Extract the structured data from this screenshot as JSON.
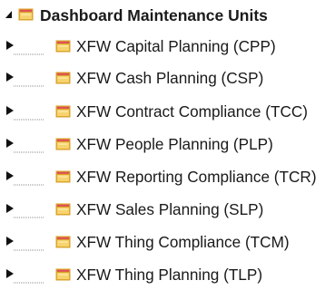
{
  "tree": {
    "root": {
      "label": "Dashboard Maintenance Units",
      "expanded": true
    },
    "children": [
      {
        "label": "XFW Capital Planning  (CPP)",
        "expanded": false
      },
      {
        "label": "XFW Cash Planning  (CSP)",
        "expanded": false
      },
      {
        "label": "XFW Contract Compliance (TCC)",
        "expanded": false
      },
      {
        "label": "XFW People Planning  (PLP)",
        "expanded": false
      },
      {
        "label": "XFW Reporting Compliance (TCR)",
        "expanded": false
      },
      {
        "label": "XFW Sales Planning  (SLP)",
        "expanded": false
      },
      {
        "label": "XFW Thing Compliance (TCM)",
        "expanded": false
      },
      {
        "label": "XFW Thing Planning  (TLP)",
        "expanded": false
      }
    ]
  },
  "icons": {
    "expanded": "triangle-down-icon",
    "collapsed": "triangle-right-icon",
    "folder": "folder-icon"
  },
  "colors": {
    "folder_fill": "#F7D36E",
    "folder_stroke": "#D8A22A",
    "folder_tab": "#E14B5A",
    "expander": "#111111",
    "connector": "#8B8B8B",
    "text": "#1A1A1A"
  }
}
